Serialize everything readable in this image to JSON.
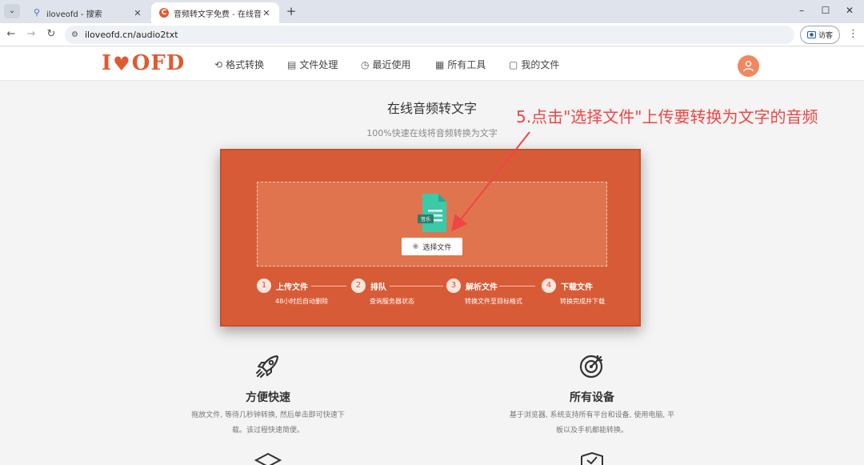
{
  "browser": {
    "tabs": [
      {
        "title": "iloveofd - 搜索",
        "icon": "search-icon"
      },
      {
        "title": "音频转文字免费 - 在线音频语音",
        "icon": "brand-icon"
      }
    ],
    "url": "iloveofd.cn/audio2txt",
    "guest_label": "访客"
  },
  "site": {
    "logo": {
      "prefix": "I",
      "suffix": "OFD"
    },
    "nav": [
      {
        "label": "格式转换",
        "icon": "convert-icon"
      },
      {
        "label": "文件处理",
        "icon": "file-process-icon"
      },
      {
        "label": "最近使用",
        "icon": "recent-icon"
      },
      {
        "label": "所有工具",
        "icon": "tools-icon"
      },
      {
        "label": "我的文件",
        "icon": "my-files-icon"
      }
    ]
  },
  "main": {
    "title": "在线音频转文字",
    "subtitle": "100%快速在线将音频转换为文字",
    "file_icon_badge": "音乐",
    "select_button": "选择文件",
    "steps": [
      {
        "num": "1",
        "label": "上传文件",
        "desc": "48小时后自动删除"
      },
      {
        "num": "2",
        "label": "排队",
        "desc": "查询服务器状态"
      },
      {
        "num": "3",
        "label": "解析文件",
        "desc": "转换文件至目标格式"
      },
      {
        "num": "4",
        "label": "下载文件",
        "desc": "转换完成并下载"
      }
    ]
  },
  "annotation": "5.点击\"选择文件\"上传要转换为文字的音频",
  "features": [
    {
      "title": "方便快速",
      "desc_line1": "拖放文件, 等待几秒钟转换, 然后单击即可快速下",
      "desc_line2": "载。该过程快速简便。",
      "icon": "rocket-icon"
    },
    {
      "title": "所有设备",
      "desc_line1": "基于浏览器, 系统支持所有平台和设备, 使用电脑, 平",
      "desc_line2": "板以及手机都能转换。",
      "icon": "target-icon"
    }
  ],
  "colors": {
    "brand": "#e05a2f",
    "panel": "#d85b37",
    "annotation": "#f04545",
    "file_icon": "#3cc9a8"
  }
}
